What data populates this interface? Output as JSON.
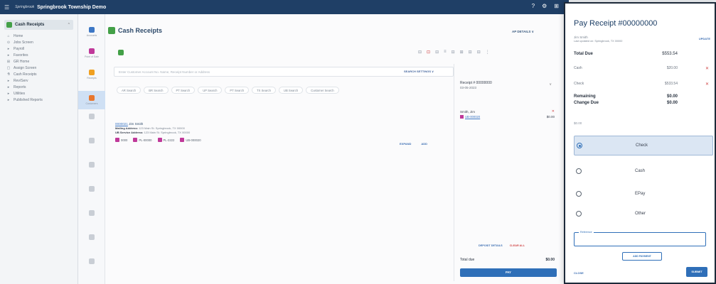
{
  "topbar": {
    "brand": "Springbrook",
    "title": "Springbrook Township Demo",
    "icons": [
      "?",
      "⚙",
      "⊞"
    ]
  },
  "nav": {
    "active": "Cash Receipts",
    "items": [
      {
        "icon": "⌂",
        "label": "Home"
      },
      {
        "icon": "⊙",
        "label": "Jobs Screen"
      },
      {
        "icon": "▸",
        "label": "Payroll"
      },
      {
        "icon": "▸",
        "label": "Favorites"
      },
      {
        "icon": "⊞",
        "label": "GR Home"
      },
      {
        "icon": "▢",
        "label": "Assign Screen"
      },
      {
        "icon": "⚗",
        "label": "Cash Receipts"
      },
      {
        "icon": "▸",
        "label": "Rev/Serv"
      },
      {
        "icon": "▸",
        "label": "Reports"
      },
      {
        "icon": "▸",
        "label": "Utilities"
      },
      {
        "icon": "▸",
        "label": "Published Reports"
      }
    ]
  },
  "rail": [
    {
      "label": "Accounts",
      "color": "#3d77c5",
      "selected": false
    },
    {
      "label": "Point of Sale",
      "color": "#c0399a",
      "selected": false
    },
    {
      "label": "Receipts",
      "color": "#f0a020",
      "selected": false
    },
    {
      "label": "Customers",
      "color": "#e8772e",
      "selected": true
    },
    {
      "label": "",
      "color": "#c9ced5",
      "selected": false
    },
    {
      "label": "",
      "color": "#c9ced5",
      "selected": false
    },
    {
      "label": "",
      "color": "#c9ced5",
      "selected": false
    },
    {
      "label": "",
      "color": "#c9ced5",
      "selected": false
    },
    {
      "label": "",
      "color": "#c9ced5",
      "selected": false
    },
    {
      "label": "",
      "color": "#c9ced5",
      "selected": false
    },
    {
      "label": "",
      "color": "#c9ced5",
      "selected": false
    }
  ],
  "page": {
    "title": "Cash Receipts",
    "ap_details": "AP DETAILS ∨",
    "toolbar_icons": [
      "⊟",
      "⊡",
      "⊟",
      "≡",
      "⊟",
      "⊞",
      "⊟",
      "⊟",
      "⋮"
    ],
    "search_placeholder": "Enter Customer Account No. Name, Receipt Number or Address",
    "search_settings": "SEARCH SETTINGS ∨",
    "chips": [
      "AR Search",
      "BR Search",
      "PT Search",
      "UP Search",
      "PT Search",
      "TX Search",
      "UB Search",
      "Customer Search"
    ]
  },
  "result": {
    "id": "0000021",
    "name": "Jim Smith",
    "mailing_label": "Mailing Address:",
    "mailing": "123 Main St. Springbrook, TX 00000",
    "service_label": "UB Service Address:",
    "service": "123 Main St. Springbrook, TX 00000",
    "badges": [
      "0000",
      "PL-00000",
      "PL-2222",
      "UB-000020"
    ],
    "links": [
      "EXPAND",
      "ADD"
    ]
  },
  "receipt": {
    "title": "Receipt # 00000000",
    "date": "03-05-2023",
    "owner": "Smith, Jim",
    "link": "UB-000020",
    "amount": "$0.00",
    "links": {
      "details": "DEPOSIT DETAILS",
      "clear": "CLEAR ALL"
    },
    "total_label": "Total due",
    "total_value": "$0.00",
    "pay": "PAY"
  },
  "modal": {
    "title": "Pay Receipt #00000000",
    "sub1": "Jim Smith",
    "sub2": "Last updated on: Springbrook, TX 00000",
    "update": "UPDATE",
    "total_due_label": "Total Due",
    "total_due": "$553.54",
    "lines": [
      {
        "label": "Cash",
        "value": "$20.00"
      },
      {
        "label": "Check",
        "value": "$533.54"
      }
    ],
    "remaining_label": "Remaining",
    "remaining": "$0.00",
    "change_label": "Change Due",
    "change": "$0.00",
    "note": "$0.00",
    "options": [
      {
        "label": "Check",
        "selected": true
      },
      {
        "label": "Cash",
        "selected": false
      },
      {
        "label": "EPay",
        "selected": false
      },
      {
        "label": "Other",
        "selected": false
      }
    ],
    "reference_label": "Reference",
    "add_payment": "ADD PAYMENT",
    "close": "CLOSE",
    "submit": "SUBMIT"
  }
}
